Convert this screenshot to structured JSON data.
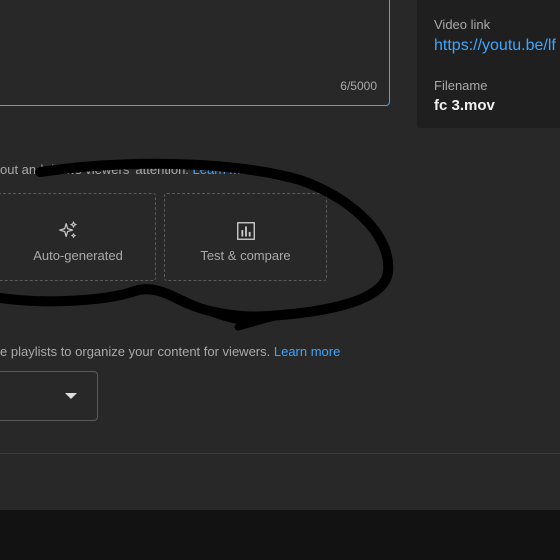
{
  "description": {
    "char_count": "6/5000"
  },
  "video_card": {
    "video_link_label": "Video link",
    "video_link_value": "https://youtu.be/lf",
    "filename_label": "Filename",
    "filename_value": "fc 3.mov"
  },
  "thumbnail": {
    "help_text": "out and draws viewers' attention. ",
    "learn_more": "Learn more",
    "options": [
      {
        "label": "Auto-generated",
        "icon": "sparkle-icon"
      },
      {
        "label": "Test & compare",
        "icon": "bar-chart-icon"
      }
    ]
  },
  "playlists": {
    "help_text": "e playlists to organize your content for viewers. ",
    "learn_more": "Learn more",
    "select_icon": "caret-down-icon"
  },
  "colors": {
    "background": "#282828",
    "accent": "#3ea6ff",
    "card": "#1f1f1f",
    "text_secondary": "#aaaaaa",
    "scribble": "#000000"
  }
}
